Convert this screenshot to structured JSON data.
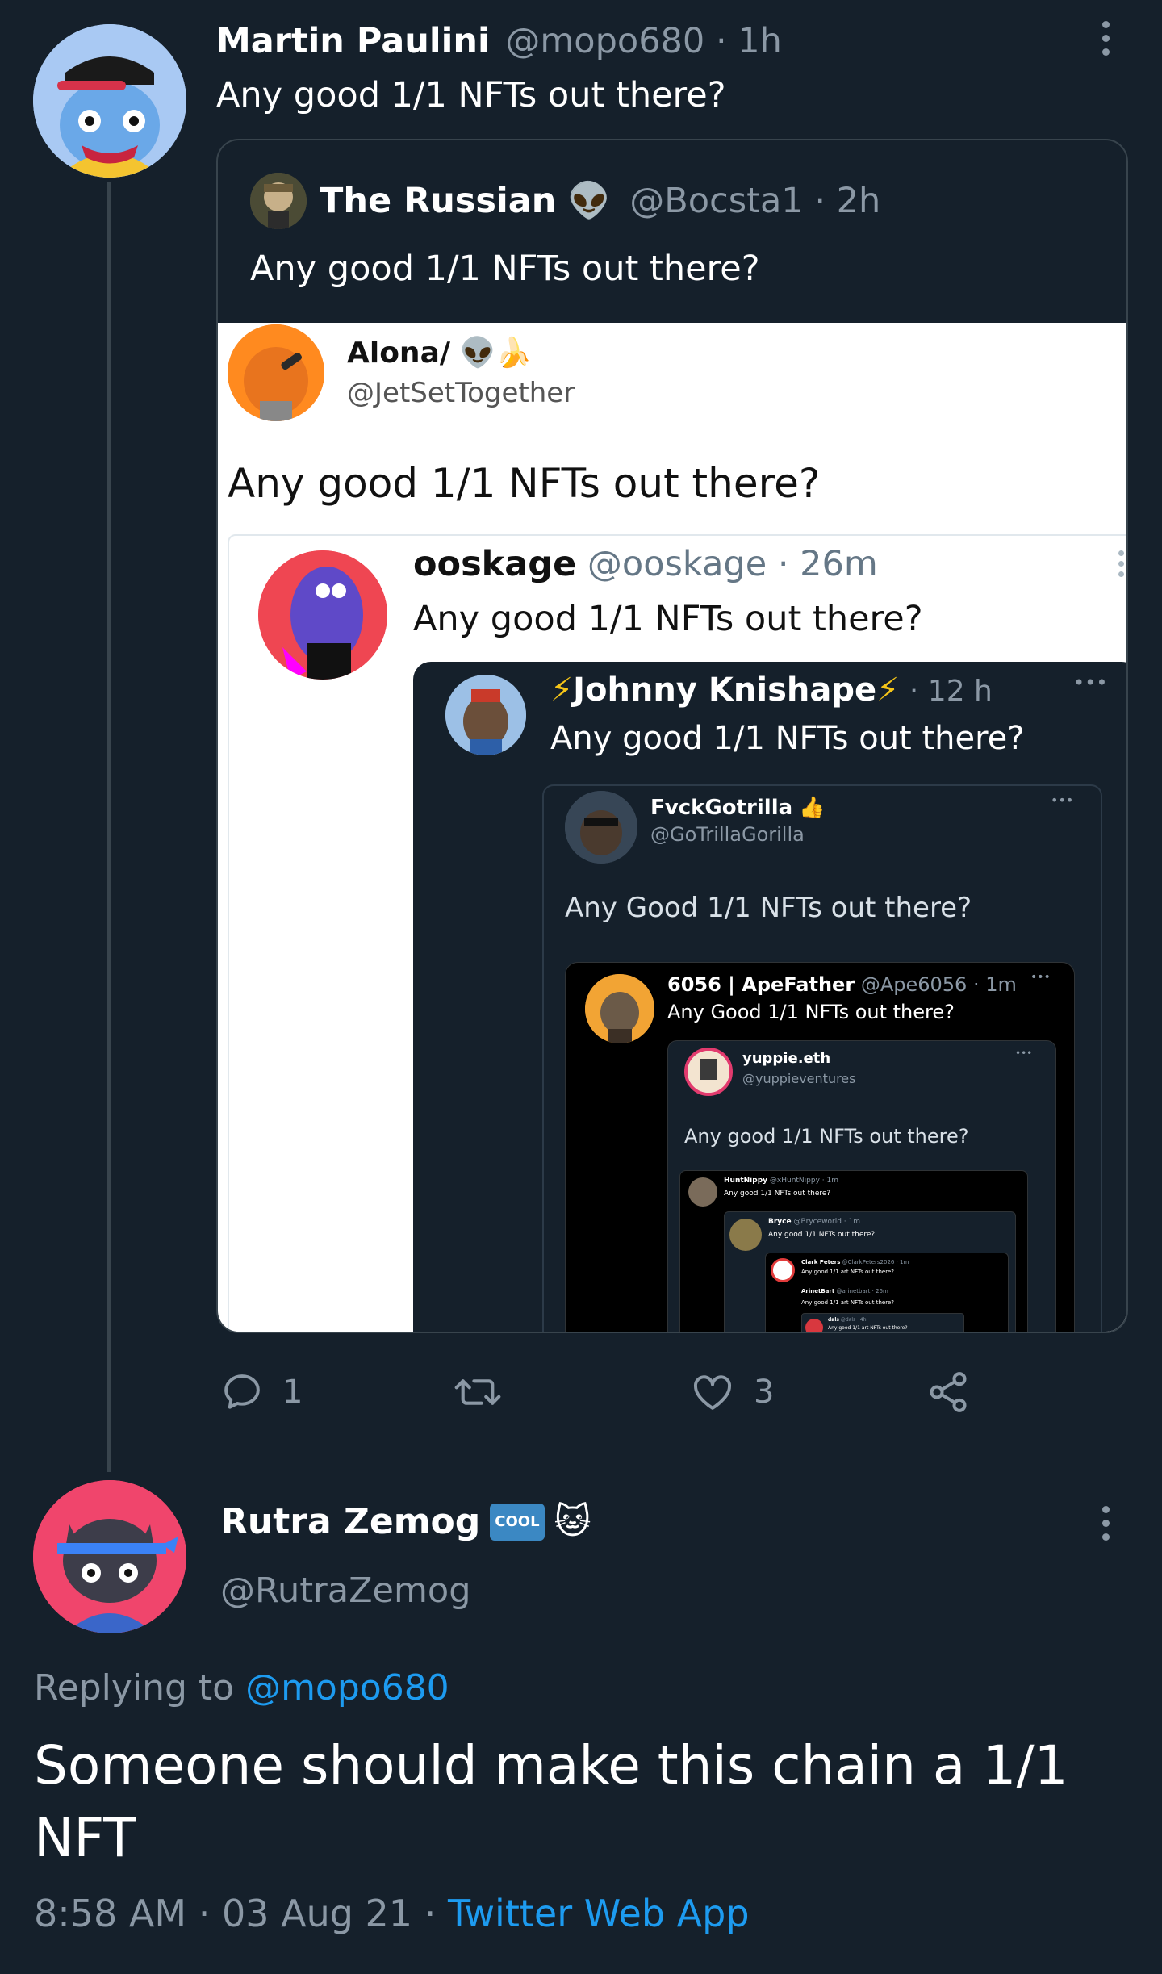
{
  "main_tweet": {
    "author_name": "Martin Paulini",
    "author_handle": "@mopo680",
    "separator": "·",
    "time": "1h",
    "text": "Any good 1/1 NFTs out there?",
    "actions": {
      "reply_count": "1",
      "like_count": "3"
    }
  },
  "quote": {
    "author_name": "The Russian",
    "author_emoji": "👽",
    "author_handle": "@Bocsta1",
    "time": "· 2h",
    "text": "Any good 1/1 NFTs out there?"
  },
  "alona": {
    "name": "Alona/",
    "handle": "@JetSetTogether",
    "text": "Any good 1/1 NFTs out there?"
  },
  "ooskage": {
    "name": "ooskage",
    "handle": "@ooskage",
    "time": "· 26m",
    "text": "Any good 1/1 NFTs out there?"
  },
  "johnny": {
    "name": "Johnny Knishape",
    "time": "· 12 h",
    "text": "Any good 1/1 NFTs out there?"
  },
  "fvck": {
    "name": "FvckGotrilla",
    "handle": "@GoTrillaGorilla",
    "text": "Any Good 1/1 NFTs out there?"
  },
  "apefather": {
    "name": "6056 | ApeFather",
    "handle_time": "@Ape6056 · 1m",
    "text": "Any Good 1/1 NFTs out there?"
  },
  "yuppie": {
    "name": "yuppie.eth",
    "handle": "@yuppieventures",
    "text": "Any good 1/1 NFTs out there?"
  },
  "hunt": {
    "name": "HuntNippy",
    "handle_time": "@xHuntNippy · 1m",
    "text": "Any good 1/1 NFTs out there?"
  },
  "bryce": {
    "name": "Bryce",
    "handle_time": "@Bryceworld · 1m",
    "text": "Any good 1/1 NFTs out there?"
  },
  "clark": {
    "name": "Clark Peters",
    "handle_time": "@ClarkPeters2026 · 1m",
    "text": "Any good 1/1 art NFTs out there?"
  },
  "arinet": {
    "name": "ArinetBart",
    "handle_time": "@arinetbart · 26m",
    "text": "Any good 1/1 art NFTs out there?"
  },
  "dals": {
    "name": "dals",
    "handle_time": "@dals · 4h",
    "text": "Any good 1/1 art NFTs out there?"
  },
  "reply": {
    "author_name": "Rutra Zemog",
    "badge": "COOL",
    "author_emoji": "🐱",
    "author_handle": "@RutraZemog",
    "replying_prefix": "Replying to",
    "replying_handle": "@mopo680",
    "text_line1": "Someone should make this chain a 1/1",
    "text_line2": "NFT",
    "timestamp": "8:58 AM · 03 Aug 21 ·",
    "source": "Twitter Web App"
  },
  "colors": {
    "background": "#15202b",
    "accent": "#1d9bf0",
    "muted": "#8b98a5",
    "text": "#ffffff"
  }
}
